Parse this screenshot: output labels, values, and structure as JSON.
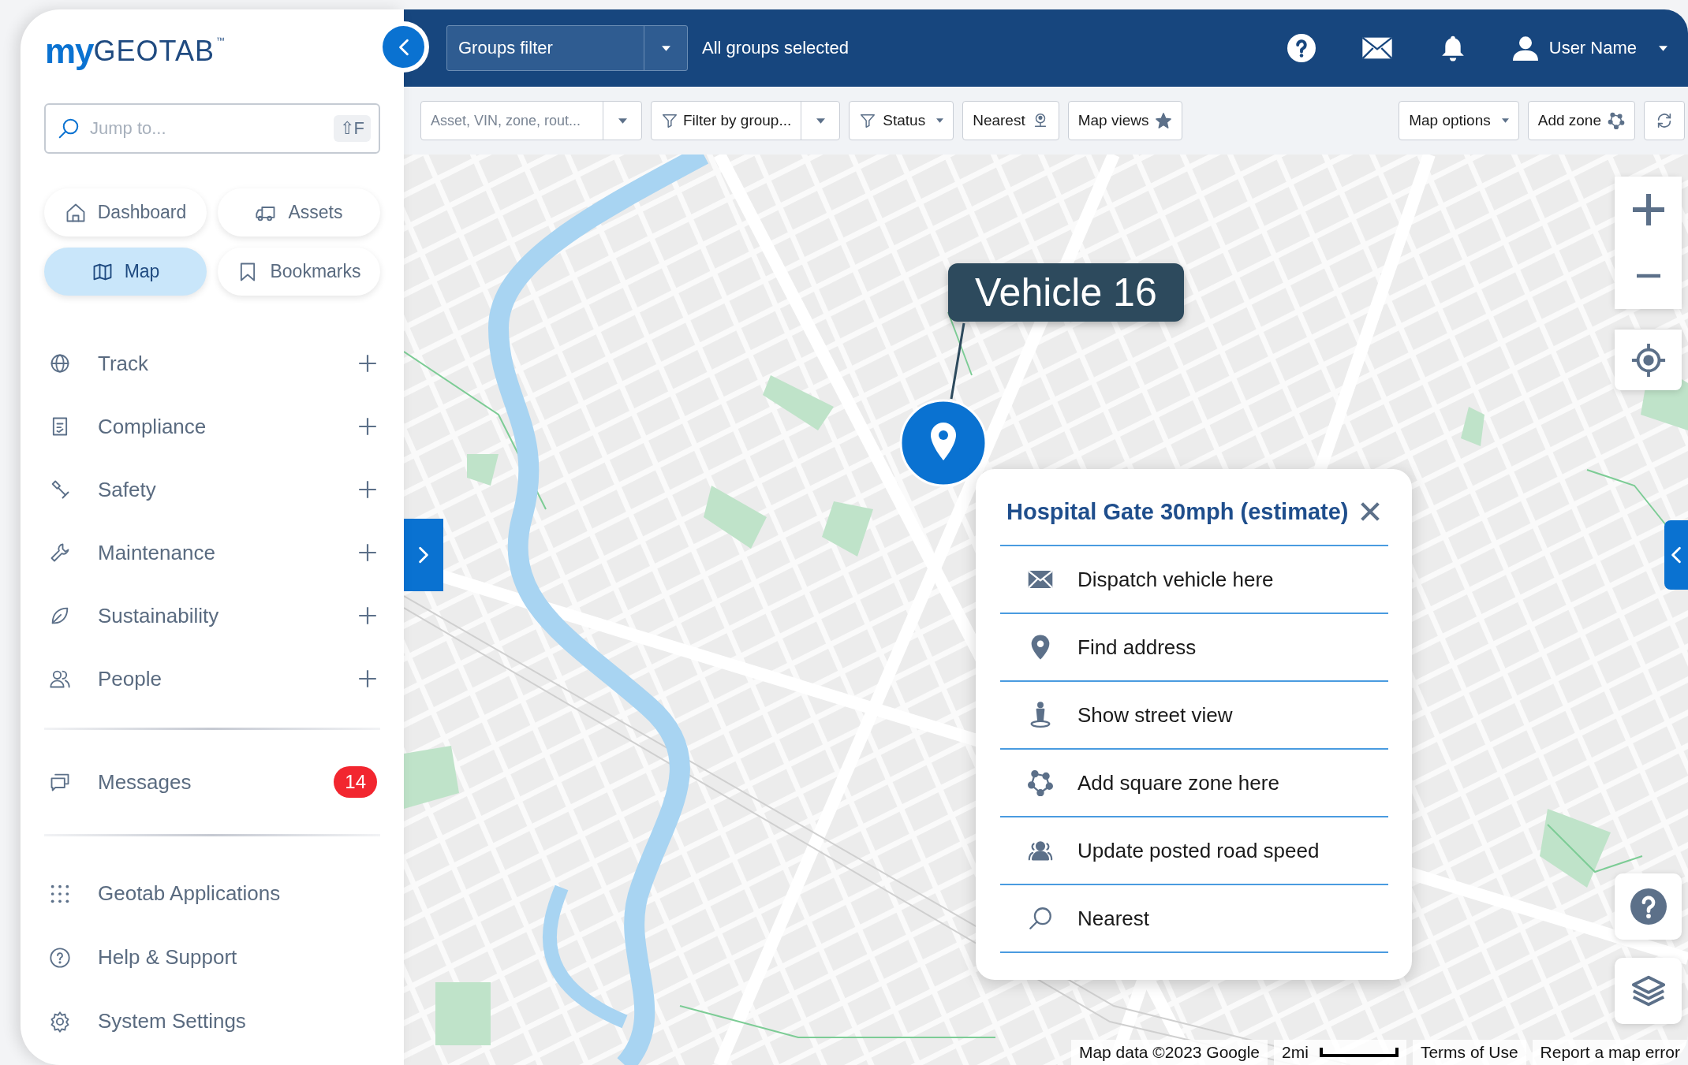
{
  "logo": {
    "prefix": "my",
    "name": "GEOTAB",
    "mark": "™"
  },
  "sidebar": {
    "search": {
      "placeholder": "Jump to...",
      "shortcut": "⇧F"
    },
    "quick_links": [
      {
        "label": "Dashboard",
        "selected": false
      },
      {
        "label": "Assets",
        "selected": false
      },
      {
        "label": "Map",
        "selected": true
      },
      {
        "label": "Bookmarks",
        "selected": false
      }
    ],
    "nav_items": [
      {
        "label": "Track",
        "expandable": true
      },
      {
        "label": "Compliance",
        "expandable": true
      },
      {
        "label": "Safety",
        "expandable": true
      },
      {
        "label": "Maintenance",
        "expandable": true
      },
      {
        "label": "Sustainability",
        "expandable": true
      },
      {
        "label": "People",
        "expandable": true
      }
    ],
    "messages": {
      "label": "Messages",
      "count": "14"
    },
    "footer_items": [
      {
        "label": "Geotab Applications"
      },
      {
        "label": "Help & Support"
      },
      {
        "label": "System Settings"
      }
    ]
  },
  "topbar": {
    "groups_filter": {
      "value": "Groups filter"
    },
    "groups_status": "All groups selected",
    "user_name": "User Name"
  },
  "toolbar": {
    "search": {
      "placeholder": "Asset, VIN, zone, rout..."
    },
    "buttons_left": [
      {
        "label": "Filter by group...",
        "kind": "split"
      },
      {
        "label": "Status",
        "kind": "dropdown"
      },
      {
        "label": "Nearest",
        "kind": "trailing"
      },
      {
        "label": "Map views",
        "kind": "trailing"
      }
    ],
    "buttons_right": [
      {
        "label": "Map options",
        "kind": "dropdown"
      },
      {
        "label": "Add zone",
        "kind": "trailing"
      }
    ]
  },
  "map": {
    "vehicle_label": "Vehicle 16",
    "popup": {
      "title": "Hospital Gate 30mph (estimate)",
      "items": [
        {
          "label": "Dispatch vehicle here"
        },
        {
          "label": "Find address"
        },
        {
          "label": "Show street view"
        },
        {
          "label": "Add square zone here"
        },
        {
          "label": "Update posted road speed"
        },
        {
          "label": "Nearest"
        }
      ]
    },
    "attribution": "Map data ©2023 Google",
    "scale": "2mi",
    "links": [
      "Terms of Use",
      "Report a map error"
    ]
  }
}
